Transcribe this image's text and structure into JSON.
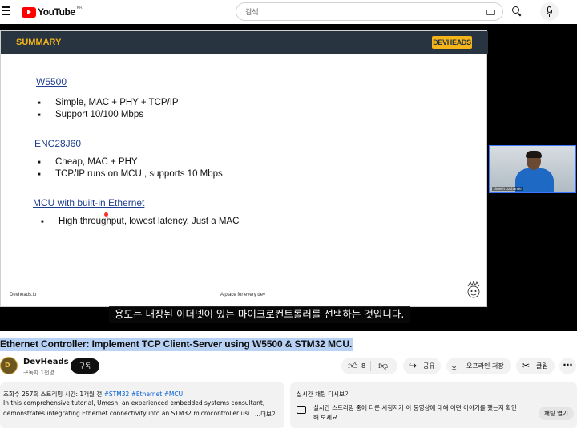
{
  "header": {
    "logo_text": "YouTube",
    "region": "KR",
    "search_placeholder": "검색"
  },
  "slide": {
    "title": "SUMMARY",
    "brand": "DEVHEADS",
    "sections": [
      {
        "heading": "W5500",
        "bullets": [
          "Simple, MAC + PHY + TCP/IP",
          "Support 10/100 Mbps"
        ]
      },
      {
        "heading": "ENC28J60",
        "bullets": [
          "Cheap, MAC + PHY",
          "TCP/IP runs on MCU , supports 10 Mbps"
        ]
      },
      {
        "heading": "MCU with built-in Ethernet",
        "bullets": [
          "High throughput, lowest latency, Just a MAC"
        ]
      }
    ],
    "footer_left": "Devheads.io",
    "footer_mid": "A place for every dev"
  },
  "webcam": {
    "name_tag": "Umesh Lokhande"
  },
  "caption": "용도는 내장된 이더넷이 있는 마이크로컨트롤러를 선택하는 것입니다.",
  "video": {
    "title": "Ethernet Controller: Implement TCP Client-Server using W5500 & STM32 MCU."
  },
  "channel": {
    "name": "DevHeads",
    "subscribers": "구독자 1천명",
    "subscribe_label": "구독",
    "avatar_text": "D"
  },
  "actions": {
    "like_count": "8",
    "share": "공유",
    "save_offline": "오프라인 저장",
    "clip": "클립",
    "more": "⋯"
  },
  "description": {
    "meta": "조회수 257회  스트리밍 시간: 1개월 전",
    "tags": "#STM32 #Ethernet #MCU",
    "line1": "In this comprehensive tutorial, Umesh, an experienced embedded systems consultant,",
    "line2": "demonstrates integrating Ethernet connectivity into an STM32 microcontroller usi",
    "more": "...더보기"
  },
  "live_chat": {
    "title": "실시간 채팅 다시보기",
    "message_line1": "실시간 스트리밍 중에 다른 시청자가 이 동영상에 대해 어떤 이야기를 했는지 확인",
    "message_line2": "해 보세요.",
    "open_label": "채팅 열기"
  },
  "colors": {
    "youtube_red": "#ff0000",
    "slide_header": "#283540",
    "slide_accent": "#f4b41a",
    "link": "#065fd4",
    "title_highlight": "#b7d2f5"
  }
}
